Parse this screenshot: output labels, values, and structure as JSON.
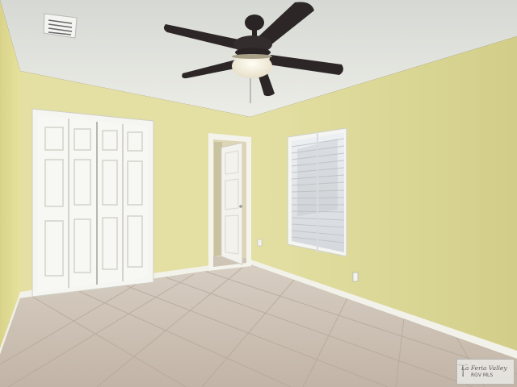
{
  "watermark": {
    "line1": "La Feria Valley",
    "line2": "RGV MLS",
    "icon": "palm-tree-icon"
  },
  "colors": {
    "ceiling": "#e4e6e0",
    "wall_left": "#e1dc93",
    "wall_back": "#e3dea0",
    "wall_right": "#d8d490",
    "floor": "#c9bdb0",
    "trim": "#f3f2ea",
    "fan_blade": "#2a2424"
  }
}
